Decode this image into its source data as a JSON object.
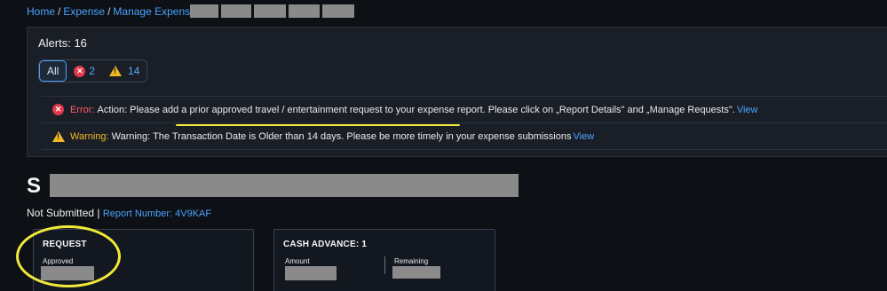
{
  "breadcrumb": {
    "home": "Home",
    "expense": "Expense",
    "manage": "Manage Expenses",
    "current": "S",
    "separator": "/"
  },
  "alerts": {
    "title": "Alerts: 16",
    "filters": {
      "all_label": "All",
      "error_count": "2",
      "warning_count": "14"
    },
    "items": [
      {
        "type": "error",
        "label": "Error:",
        "text": "Action: Please add a prior approved travel / entertainment request to your expense report. Please click on „Report Details\" and „Manage Requests\".",
        "link": "View"
      },
      {
        "type": "warning",
        "label": "Warning:",
        "text": "Warning: The Transaction Date is Older than 14 days. Please be more timely in your expense submissions",
        "link": "View"
      }
    ]
  },
  "report": {
    "initial": "S",
    "status": "Not Submitted |",
    "report_number": "Report Number: 4V9KAF"
  },
  "cards": {
    "request": {
      "title": "REQUEST",
      "status_label": "Approved"
    },
    "cash_advance": {
      "title": "CASH ADVANCE: 1",
      "amount_label": "Amount",
      "remaining_label": "Remaining"
    }
  },
  "colors": {
    "background": "#0d1014",
    "panel": "#1a1f27",
    "link": "#4aa3ff",
    "error": "#e2384b",
    "warning": "#f2b824",
    "annotation": "#f2e83a"
  }
}
